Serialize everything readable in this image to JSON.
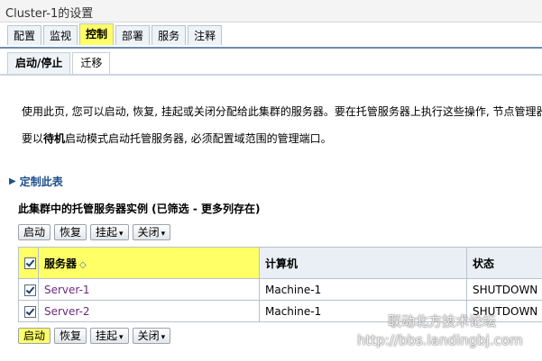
{
  "window": {
    "title": "Cluster-1的设置"
  },
  "tabs": [
    {
      "label": "配置",
      "selected": false
    },
    {
      "label": "监视",
      "selected": false
    },
    {
      "label": "控制",
      "selected": true
    },
    {
      "label": "部署",
      "selected": false
    },
    {
      "label": "服务",
      "selected": false
    },
    {
      "label": "注释",
      "selected": false
    }
  ],
  "subtabs": [
    {
      "label": "启动/停止",
      "selected": true
    },
    {
      "label": "迁移",
      "selected": false
    }
  ],
  "description": {
    "line1": "使用此页, 您可以启动, 恢复, 挂起或关闭分配给此集群的服务器。要在托管服务器上执行这些操作, 节点管理器",
    "line2_prefix": "要以",
    "line2_bold": "待机",
    "line2_suffix": "启动模式启动托管服务器, 必须配置域范围的管理端口。"
  },
  "customize": {
    "label": "定制此表"
  },
  "table": {
    "title": "此集群中的托管服务器实例 (已筛选 - 更多列存在)",
    "toolbar": {
      "start": "启动",
      "resume": "恢复",
      "suspend": "挂起",
      "shutdown": "关闭"
    },
    "columns": [
      "服务器",
      "计算机",
      "状态"
    ],
    "rows": [
      {
        "server": "Server-1",
        "machine": "Machine-1",
        "state": "SHUTDOWN"
      },
      {
        "server": "Server-2",
        "machine": "Machine-1",
        "state": "SHUTDOWN"
      }
    ]
  },
  "watermark": {
    "line1": "联动北方技术论坛",
    "line2": "http://bbs.landingbj.com"
  },
  "colors": {
    "highlight": "#ffff66",
    "link": "#6b2a7a",
    "header_bg": "#e9eff5"
  }
}
